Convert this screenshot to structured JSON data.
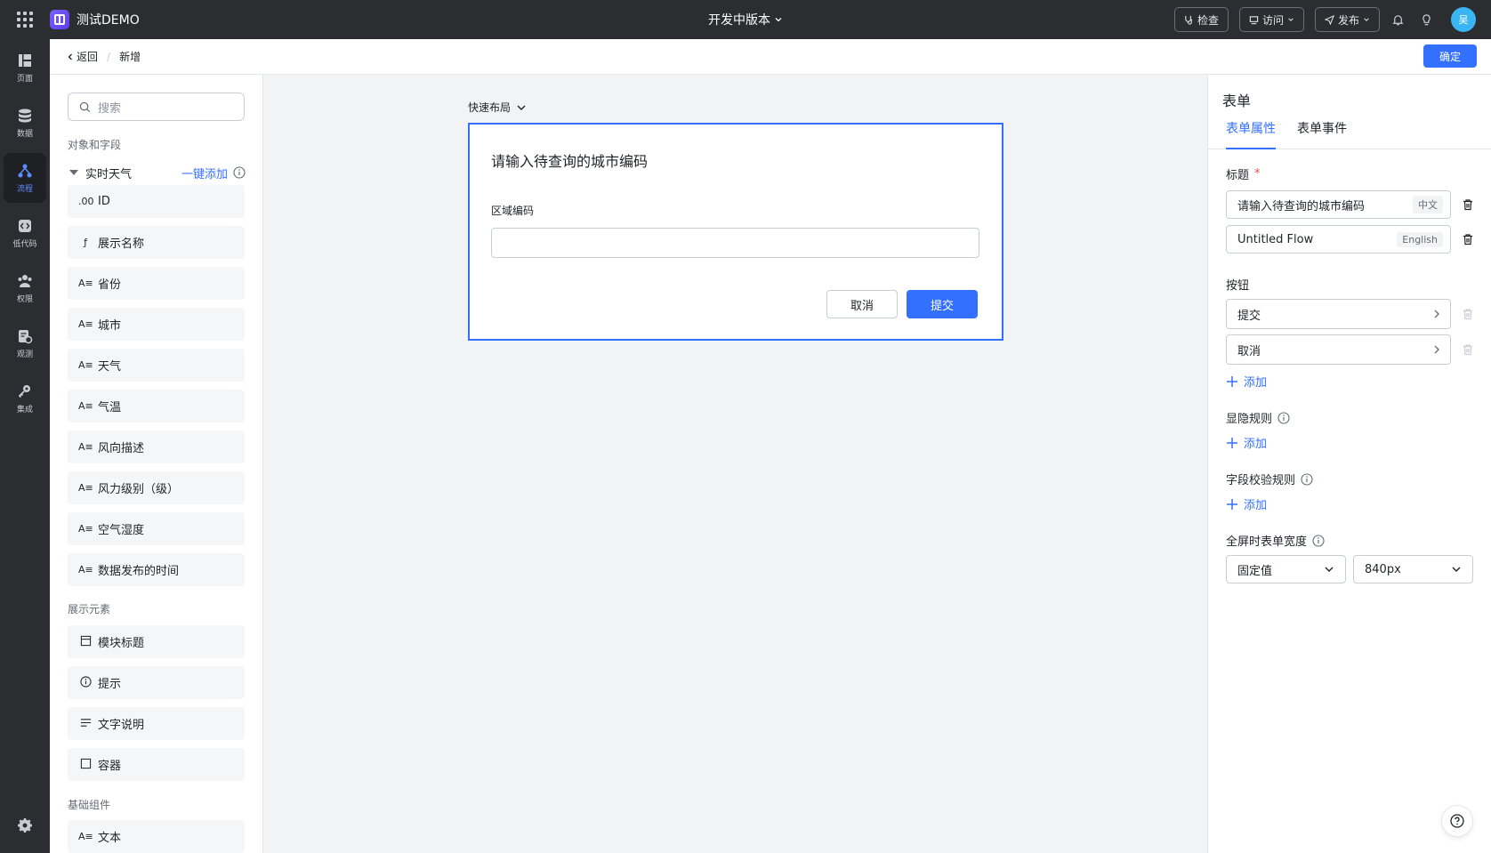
{
  "app": {
    "title": "测试DEMO",
    "version": "开发中版本"
  },
  "topbar": {
    "check_label": "检查",
    "visit_label": "访问",
    "publish_label": "发布",
    "avatar_text": "吴"
  },
  "leftnav": {
    "items": [
      {
        "label": "页面",
        "icon": "page-icon"
      },
      {
        "label": "数据",
        "icon": "database-icon"
      },
      {
        "label": "流程",
        "icon": "flow-icon"
      },
      {
        "label": "低代码",
        "icon": "code-icon"
      },
      {
        "label": "权限",
        "icon": "users-icon"
      },
      {
        "label": "观测",
        "icon": "monitor-icon"
      },
      {
        "label": "集成",
        "icon": "key-icon"
      }
    ]
  },
  "subheader": {
    "back_label": "返回",
    "crumb": "新增",
    "confirm_label": "确定"
  },
  "leftpanel": {
    "search_placeholder": "搜索",
    "section_objects": "对象和字段",
    "group_name": "实时天气",
    "one_click_add": "一键添加",
    "fields": [
      {
        "icon": ".00",
        "label": "ID"
      },
      {
        "icon": "ƒ",
        "label": "展示名称"
      },
      {
        "icon": "A≡",
        "label": "省份"
      },
      {
        "icon": "A≡",
        "label": "城市"
      },
      {
        "icon": "A≡",
        "label": "天气"
      },
      {
        "icon": "A≡",
        "label": "气温"
      },
      {
        "icon": "A≡",
        "label": "风向描述"
      },
      {
        "icon": "A≡",
        "label": "风力级别（级）"
      },
      {
        "icon": "A≡",
        "label": "空气湿度"
      },
      {
        "icon": "A≡",
        "label": "数据发布的时间"
      }
    ],
    "section_display": "展示元素",
    "display_items": [
      {
        "icon": "block-title-icon",
        "label": "模块标题"
      },
      {
        "icon": "info-icon",
        "label": "提示"
      },
      {
        "icon": "text-desc-icon",
        "label": "文字说明"
      },
      {
        "icon": "container-icon",
        "label": "容器"
      }
    ],
    "section_basic": "基础组件",
    "basic_items": [
      {
        "icon": "A≡",
        "label": "文本"
      }
    ]
  },
  "canvas": {
    "quick_layout": "快速布局",
    "form": {
      "title": "请输入待查询的城市编码",
      "field_label": "区域编码",
      "field_value": "",
      "cancel_label": "取消",
      "submit_label": "提交"
    }
  },
  "rightpanel": {
    "title": "表单",
    "tabs": [
      "表单属性",
      "表单事件"
    ],
    "title_label": "标题",
    "title_zh": "请输入待查询的城市编码",
    "title_zh_tag": "中文",
    "title_en": "Untitled Flow",
    "title_en_tag": "English",
    "buttons_label": "按钮",
    "buttons": [
      "提交",
      "取消"
    ],
    "add_label": "添加",
    "visibility_label": "显隐规则",
    "validation_label": "字段校验规则",
    "width_label": "全屏时表单宽度",
    "width_mode": "固定值",
    "width_value": "840px"
  },
  "colors": {
    "accent": "#3370ff",
    "nav_bg": "#2b2d31",
    "required": "#f54a45"
  }
}
